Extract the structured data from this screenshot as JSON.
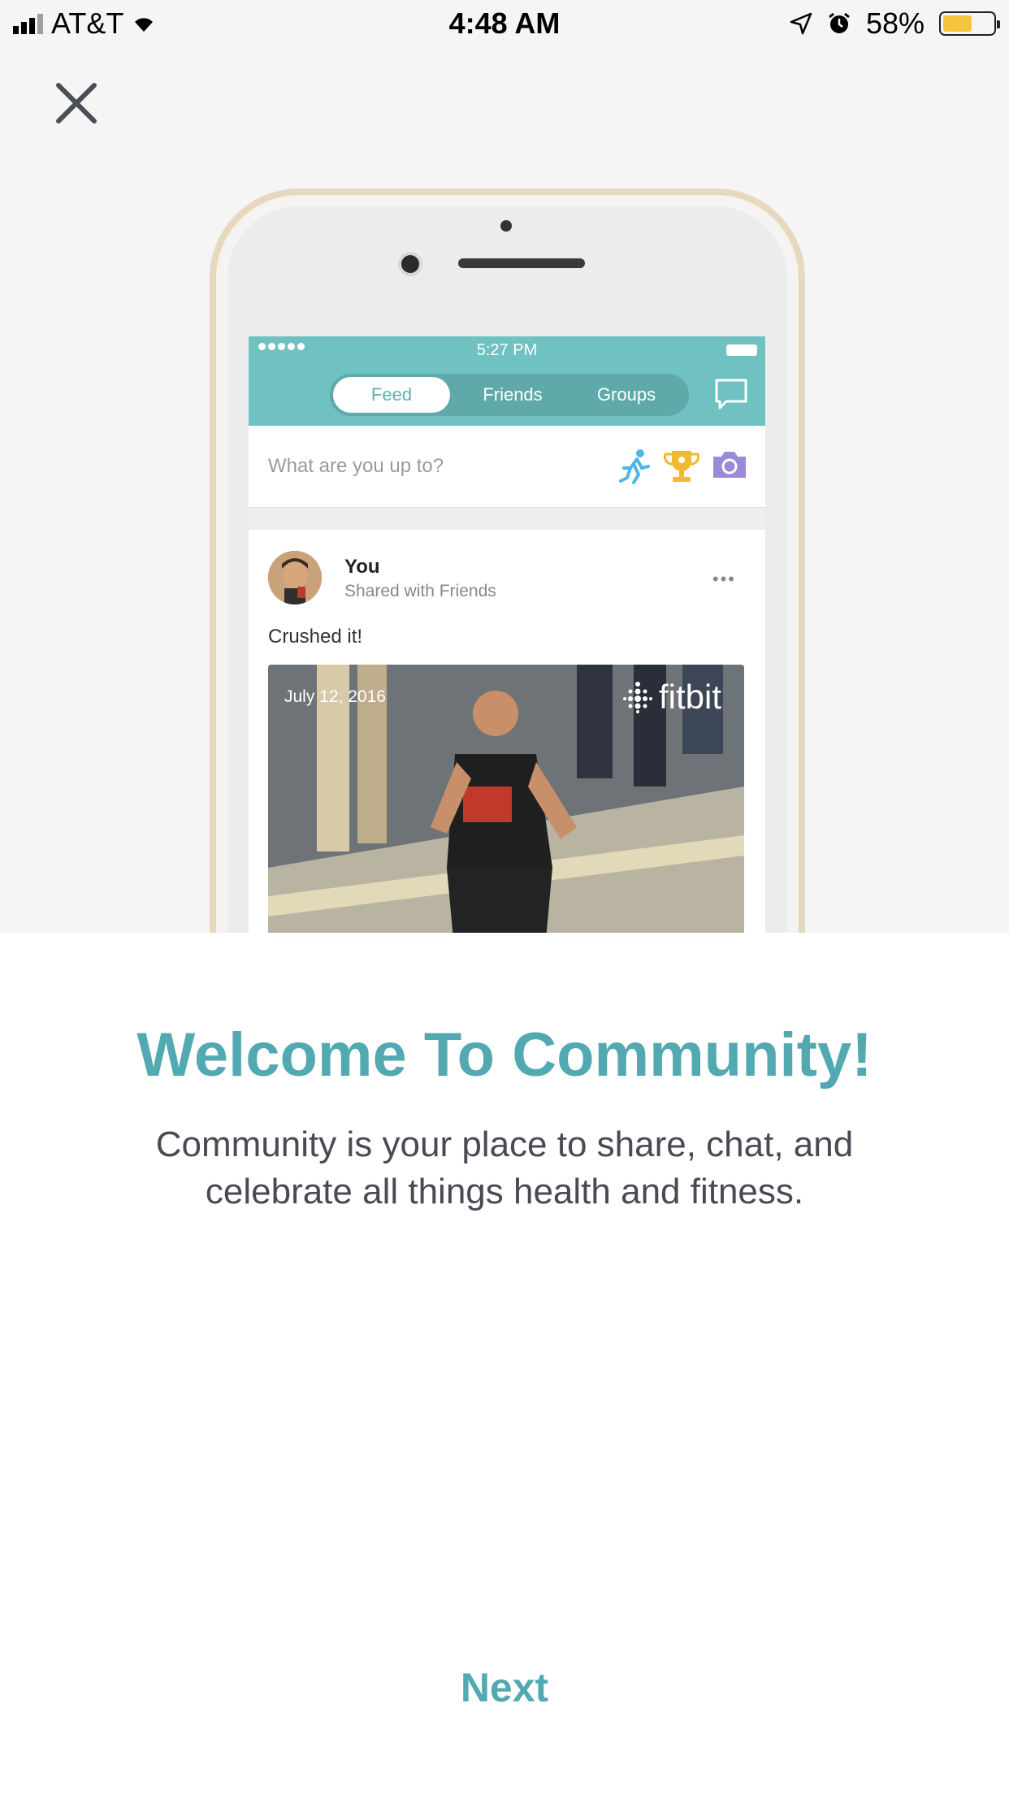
{
  "status_bar": {
    "carrier": "AT&T",
    "time": "4:48 AM",
    "battery_percent": "58%",
    "battery_level": 0.58,
    "icons": [
      "signal-icon",
      "wifi-icon",
      "location-icon",
      "alarm-icon",
      "battery-icon"
    ]
  },
  "close": {
    "icon": "close-icon"
  },
  "mockup": {
    "status_time": "5:27 PM",
    "tabs": [
      {
        "label": "Feed",
        "active": true
      },
      {
        "label": "Friends",
        "active": false
      },
      {
        "label": "Groups",
        "active": false
      }
    ],
    "compose_placeholder": "What are you up to?",
    "post": {
      "name": "You",
      "meta": "Shared with Friends",
      "more": "•••",
      "text": "Crushed it!",
      "photo_date": "July 12, 2016",
      "photo_brand": "fitbit"
    }
  },
  "content": {
    "title": "Welcome To Community!",
    "description": "Community is your place to share, chat, and celebrate all things health and fitness."
  },
  "footer": {
    "next_label": "Next"
  },
  "colors": {
    "accent": "#53a9b1",
    "header": "#70c1c1",
    "text": "#4a4a55"
  }
}
